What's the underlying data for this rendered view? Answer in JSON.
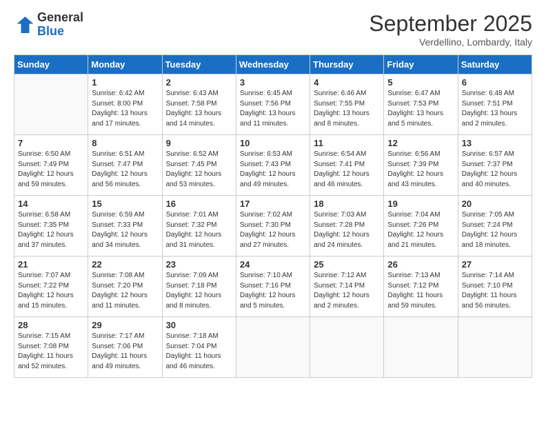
{
  "logo": {
    "general": "General",
    "blue": "Blue"
  },
  "title": "September 2025",
  "subtitle": "Verdellino, Lombardy, Italy",
  "headers": [
    "Sunday",
    "Monday",
    "Tuesday",
    "Wednesday",
    "Thursday",
    "Friday",
    "Saturday"
  ],
  "weeks": [
    [
      {
        "day": "",
        "info": ""
      },
      {
        "day": "1",
        "info": "Sunrise: 6:42 AM\nSunset: 8:00 PM\nDaylight: 13 hours\nand 17 minutes."
      },
      {
        "day": "2",
        "info": "Sunrise: 6:43 AM\nSunset: 7:58 PM\nDaylight: 13 hours\nand 14 minutes."
      },
      {
        "day": "3",
        "info": "Sunrise: 6:45 AM\nSunset: 7:56 PM\nDaylight: 13 hours\nand 11 minutes."
      },
      {
        "day": "4",
        "info": "Sunrise: 6:46 AM\nSunset: 7:55 PM\nDaylight: 13 hours\nand 8 minutes."
      },
      {
        "day": "5",
        "info": "Sunrise: 6:47 AM\nSunset: 7:53 PM\nDaylight: 13 hours\nand 5 minutes."
      },
      {
        "day": "6",
        "info": "Sunrise: 6:48 AM\nSunset: 7:51 PM\nDaylight: 13 hours\nand 2 minutes."
      }
    ],
    [
      {
        "day": "7",
        "info": "Sunrise: 6:50 AM\nSunset: 7:49 PM\nDaylight: 12 hours\nand 59 minutes."
      },
      {
        "day": "8",
        "info": "Sunrise: 6:51 AM\nSunset: 7:47 PM\nDaylight: 12 hours\nand 56 minutes."
      },
      {
        "day": "9",
        "info": "Sunrise: 6:52 AM\nSunset: 7:45 PM\nDaylight: 12 hours\nand 53 minutes."
      },
      {
        "day": "10",
        "info": "Sunrise: 6:53 AM\nSunset: 7:43 PM\nDaylight: 12 hours\nand 49 minutes."
      },
      {
        "day": "11",
        "info": "Sunrise: 6:54 AM\nSunset: 7:41 PM\nDaylight: 12 hours\nand 46 minutes."
      },
      {
        "day": "12",
        "info": "Sunrise: 6:56 AM\nSunset: 7:39 PM\nDaylight: 12 hours\nand 43 minutes."
      },
      {
        "day": "13",
        "info": "Sunrise: 6:57 AM\nSunset: 7:37 PM\nDaylight: 12 hours\nand 40 minutes."
      }
    ],
    [
      {
        "day": "14",
        "info": "Sunrise: 6:58 AM\nSunset: 7:35 PM\nDaylight: 12 hours\nand 37 minutes."
      },
      {
        "day": "15",
        "info": "Sunrise: 6:59 AM\nSunset: 7:33 PM\nDaylight: 12 hours\nand 34 minutes."
      },
      {
        "day": "16",
        "info": "Sunrise: 7:01 AM\nSunset: 7:32 PM\nDaylight: 12 hours\nand 31 minutes."
      },
      {
        "day": "17",
        "info": "Sunrise: 7:02 AM\nSunset: 7:30 PM\nDaylight: 12 hours\nand 27 minutes."
      },
      {
        "day": "18",
        "info": "Sunrise: 7:03 AM\nSunset: 7:28 PM\nDaylight: 12 hours\nand 24 minutes."
      },
      {
        "day": "19",
        "info": "Sunrise: 7:04 AM\nSunset: 7:26 PM\nDaylight: 12 hours\nand 21 minutes."
      },
      {
        "day": "20",
        "info": "Sunrise: 7:05 AM\nSunset: 7:24 PM\nDaylight: 12 hours\nand 18 minutes."
      }
    ],
    [
      {
        "day": "21",
        "info": "Sunrise: 7:07 AM\nSunset: 7:22 PM\nDaylight: 12 hours\nand 15 minutes."
      },
      {
        "day": "22",
        "info": "Sunrise: 7:08 AM\nSunset: 7:20 PM\nDaylight: 12 hours\nand 11 minutes."
      },
      {
        "day": "23",
        "info": "Sunrise: 7:09 AM\nSunset: 7:18 PM\nDaylight: 12 hours\nand 8 minutes."
      },
      {
        "day": "24",
        "info": "Sunrise: 7:10 AM\nSunset: 7:16 PM\nDaylight: 12 hours\nand 5 minutes."
      },
      {
        "day": "25",
        "info": "Sunrise: 7:12 AM\nSunset: 7:14 PM\nDaylight: 12 hours\nand 2 minutes."
      },
      {
        "day": "26",
        "info": "Sunrise: 7:13 AM\nSunset: 7:12 PM\nDaylight: 11 hours\nand 59 minutes."
      },
      {
        "day": "27",
        "info": "Sunrise: 7:14 AM\nSunset: 7:10 PM\nDaylight: 11 hours\nand 56 minutes."
      }
    ],
    [
      {
        "day": "28",
        "info": "Sunrise: 7:15 AM\nSunset: 7:08 PM\nDaylight: 11 hours\nand 52 minutes."
      },
      {
        "day": "29",
        "info": "Sunrise: 7:17 AM\nSunset: 7:06 PM\nDaylight: 11 hours\nand 49 minutes."
      },
      {
        "day": "30",
        "info": "Sunrise: 7:18 AM\nSunset: 7:04 PM\nDaylight: 11 hours\nand 46 minutes."
      },
      {
        "day": "",
        "info": ""
      },
      {
        "day": "",
        "info": ""
      },
      {
        "day": "",
        "info": ""
      },
      {
        "day": "",
        "info": ""
      }
    ]
  ]
}
